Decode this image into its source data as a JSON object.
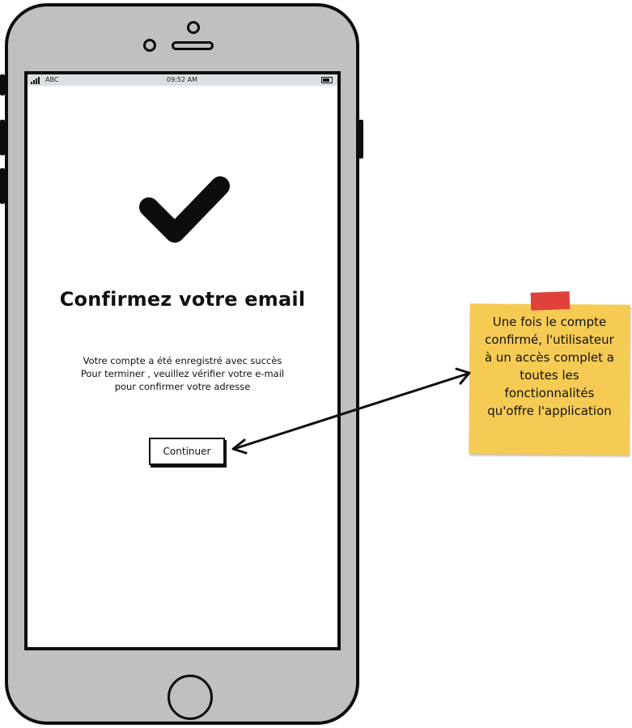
{
  "status_bar": {
    "carrier": "ABC",
    "time": "09:52 AM"
  },
  "confirmation": {
    "title": "Confirmez votre email",
    "message_lines": [
      "Votre compte a été enregistré avec succès",
      "Pour terminer , veuillez vérifier votre e-mail",
      "pour confirmer votre adresse"
    ],
    "continue_label": "Continuer"
  },
  "note": {
    "lines": [
      "Une fois le compte",
      "confirmé, l'utilisateur",
      "à un accès complet a",
      "toutes les",
      "fonctionnalités",
      "qu'offre l'application"
    ]
  },
  "icons": {
    "check": "checkmark-icon",
    "arrow": "double-arrow"
  },
  "colors": {
    "phone_body": "#c0c0c0",
    "status_bar": "#d9e1e3",
    "note": "#f5cb54",
    "tape": "#e0413a"
  }
}
